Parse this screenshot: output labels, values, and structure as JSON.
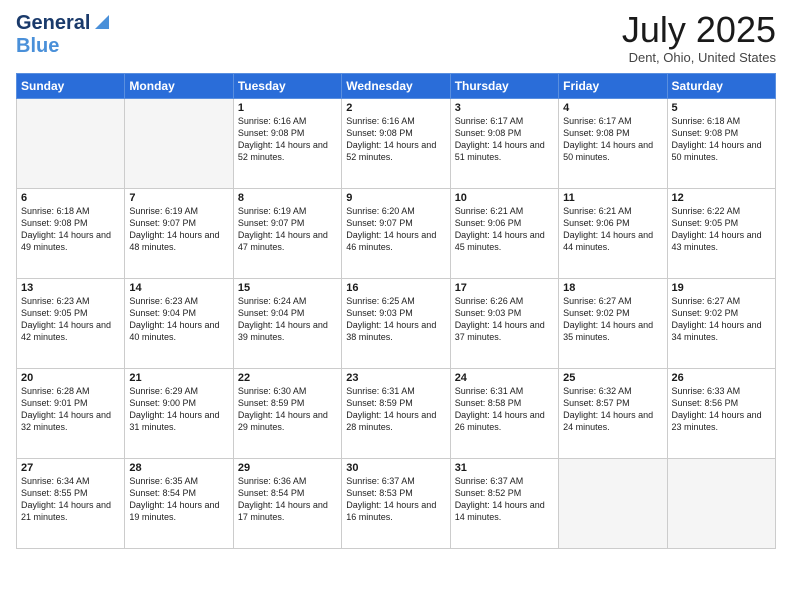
{
  "header": {
    "logo_general": "General",
    "logo_blue": "Blue",
    "month_title": "July 2025",
    "location": "Dent, Ohio, United States"
  },
  "weekdays": [
    "Sunday",
    "Monday",
    "Tuesday",
    "Wednesday",
    "Thursday",
    "Friday",
    "Saturday"
  ],
  "weeks": [
    [
      {
        "day": "",
        "info": ""
      },
      {
        "day": "",
        "info": ""
      },
      {
        "day": "1",
        "info": "Sunrise: 6:16 AM\nSunset: 9:08 PM\nDaylight: 14 hours and 52 minutes."
      },
      {
        "day": "2",
        "info": "Sunrise: 6:16 AM\nSunset: 9:08 PM\nDaylight: 14 hours and 52 minutes."
      },
      {
        "day": "3",
        "info": "Sunrise: 6:17 AM\nSunset: 9:08 PM\nDaylight: 14 hours and 51 minutes."
      },
      {
        "day": "4",
        "info": "Sunrise: 6:17 AM\nSunset: 9:08 PM\nDaylight: 14 hours and 50 minutes."
      },
      {
        "day": "5",
        "info": "Sunrise: 6:18 AM\nSunset: 9:08 PM\nDaylight: 14 hours and 50 minutes."
      }
    ],
    [
      {
        "day": "6",
        "info": "Sunrise: 6:18 AM\nSunset: 9:08 PM\nDaylight: 14 hours and 49 minutes."
      },
      {
        "day": "7",
        "info": "Sunrise: 6:19 AM\nSunset: 9:07 PM\nDaylight: 14 hours and 48 minutes."
      },
      {
        "day": "8",
        "info": "Sunrise: 6:19 AM\nSunset: 9:07 PM\nDaylight: 14 hours and 47 minutes."
      },
      {
        "day": "9",
        "info": "Sunrise: 6:20 AM\nSunset: 9:07 PM\nDaylight: 14 hours and 46 minutes."
      },
      {
        "day": "10",
        "info": "Sunrise: 6:21 AM\nSunset: 9:06 PM\nDaylight: 14 hours and 45 minutes."
      },
      {
        "day": "11",
        "info": "Sunrise: 6:21 AM\nSunset: 9:06 PM\nDaylight: 14 hours and 44 minutes."
      },
      {
        "day": "12",
        "info": "Sunrise: 6:22 AM\nSunset: 9:05 PM\nDaylight: 14 hours and 43 minutes."
      }
    ],
    [
      {
        "day": "13",
        "info": "Sunrise: 6:23 AM\nSunset: 9:05 PM\nDaylight: 14 hours and 42 minutes."
      },
      {
        "day": "14",
        "info": "Sunrise: 6:23 AM\nSunset: 9:04 PM\nDaylight: 14 hours and 40 minutes."
      },
      {
        "day": "15",
        "info": "Sunrise: 6:24 AM\nSunset: 9:04 PM\nDaylight: 14 hours and 39 minutes."
      },
      {
        "day": "16",
        "info": "Sunrise: 6:25 AM\nSunset: 9:03 PM\nDaylight: 14 hours and 38 minutes."
      },
      {
        "day": "17",
        "info": "Sunrise: 6:26 AM\nSunset: 9:03 PM\nDaylight: 14 hours and 37 minutes."
      },
      {
        "day": "18",
        "info": "Sunrise: 6:27 AM\nSunset: 9:02 PM\nDaylight: 14 hours and 35 minutes."
      },
      {
        "day": "19",
        "info": "Sunrise: 6:27 AM\nSunset: 9:02 PM\nDaylight: 14 hours and 34 minutes."
      }
    ],
    [
      {
        "day": "20",
        "info": "Sunrise: 6:28 AM\nSunset: 9:01 PM\nDaylight: 14 hours and 32 minutes."
      },
      {
        "day": "21",
        "info": "Sunrise: 6:29 AM\nSunset: 9:00 PM\nDaylight: 14 hours and 31 minutes."
      },
      {
        "day": "22",
        "info": "Sunrise: 6:30 AM\nSunset: 8:59 PM\nDaylight: 14 hours and 29 minutes."
      },
      {
        "day": "23",
        "info": "Sunrise: 6:31 AM\nSunset: 8:59 PM\nDaylight: 14 hours and 28 minutes."
      },
      {
        "day": "24",
        "info": "Sunrise: 6:31 AM\nSunset: 8:58 PM\nDaylight: 14 hours and 26 minutes."
      },
      {
        "day": "25",
        "info": "Sunrise: 6:32 AM\nSunset: 8:57 PM\nDaylight: 14 hours and 24 minutes."
      },
      {
        "day": "26",
        "info": "Sunrise: 6:33 AM\nSunset: 8:56 PM\nDaylight: 14 hours and 23 minutes."
      }
    ],
    [
      {
        "day": "27",
        "info": "Sunrise: 6:34 AM\nSunset: 8:55 PM\nDaylight: 14 hours and 21 minutes."
      },
      {
        "day": "28",
        "info": "Sunrise: 6:35 AM\nSunset: 8:54 PM\nDaylight: 14 hours and 19 minutes."
      },
      {
        "day": "29",
        "info": "Sunrise: 6:36 AM\nSunset: 8:54 PM\nDaylight: 14 hours and 17 minutes."
      },
      {
        "day": "30",
        "info": "Sunrise: 6:37 AM\nSunset: 8:53 PM\nDaylight: 14 hours and 16 minutes."
      },
      {
        "day": "31",
        "info": "Sunrise: 6:37 AM\nSunset: 8:52 PM\nDaylight: 14 hours and 14 minutes."
      },
      {
        "day": "",
        "info": ""
      },
      {
        "day": "",
        "info": ""
      }
    ]
  ]
}
